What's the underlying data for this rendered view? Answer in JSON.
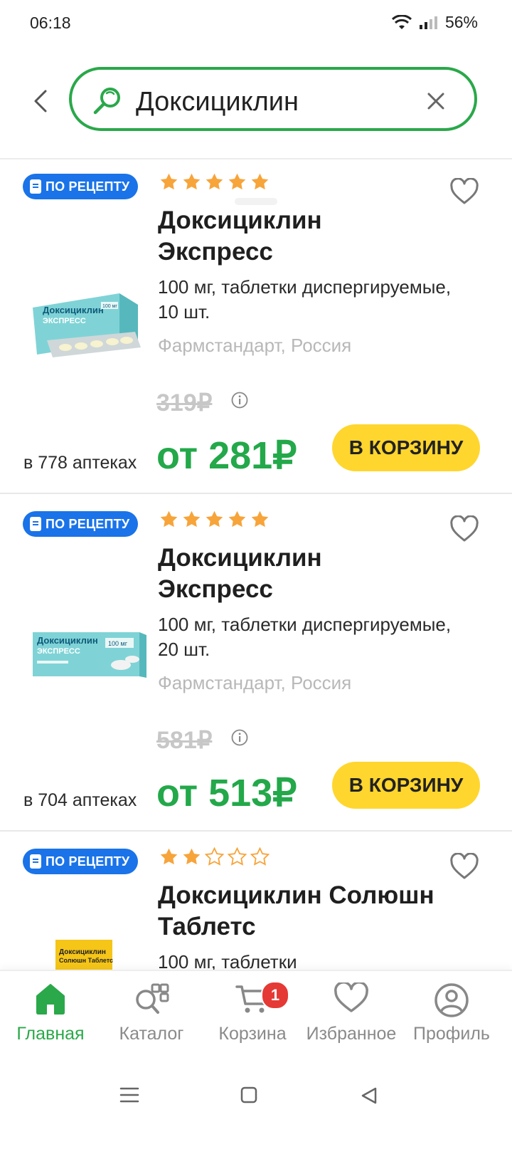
{
  "status": {
    "time": "06:18",
    "battery": "56%"
  },
  "search": {
    "value": "Доксициклин"
  },
  "products": [
    {
      "badge": "ПО РЕЦЕПТУ",
      "rating": 5,
      "name": "Доксициклин Экспресс",
      "desc": "100 мг, таблетки диспергируемые, 10 шт.",
      "maker": "Фармстандарт, Россия",
      "old_price": "319₽",
      "availability": "в 778 аптеках",
      "price": "от 281₽",
      "cart_label": "В КОРЗИНУ",
      "image": {
        "brand": "Доксициклин",
        "sub": "ЭКСПРЕСС",
        "dose": "100 мг"
      }
    },
    {
      "badge": "ПО РЕЦЕПТУ",
      "rating": 5,
      "name": "Доксициклин Экспресс",
      "desc": "100 мг, таблетки диспергируемые, 20 шт.",
      "maker": "Фармстандарт, Россия",
      "old_price": "581₽",
      "availability": "в 704 аптеках",
      "price": "от 513₽",
      "cart_label": "В КОРЗИНУ",
      "image": {
        "brand": "Доксициклин",
        "sub": "ЭКСПРЕСС",
        "dose": "100 мг"
      }
    },
    {
      "badge": "ПО РЕЦЕПТУ",
      "rating": 2,
      "name": "Доксициклин Солюшн Таблетс",
      "desc": "100 мг, таблетки",
      "image": {
        "brand": "Доксициклин",
        "sub": "Солюшн Таблетс"
      }
    }
  ],
  "nav": {
    "home": "Главная",
    "catalog": "Каталог",
    "cart": "Корзина",
    "cart_count": "1",
    "favorites": "Избранное",
    "profile": "Профиль"
  },
  "colors": {
    "accent": "#2aa84a",
    "badge": "#1a73e8",
    "button": "#ffd62e",
    "star": "#f7a43a"
  },
  "icons": [
    "back-icon",
    "search-icon",
    "clear-icon",
    "heart-icon",
    "info-icon",
    "home-icon",
    "catalog-icon",
    "cart-icon",
    "profile-icon"
  ]
}
